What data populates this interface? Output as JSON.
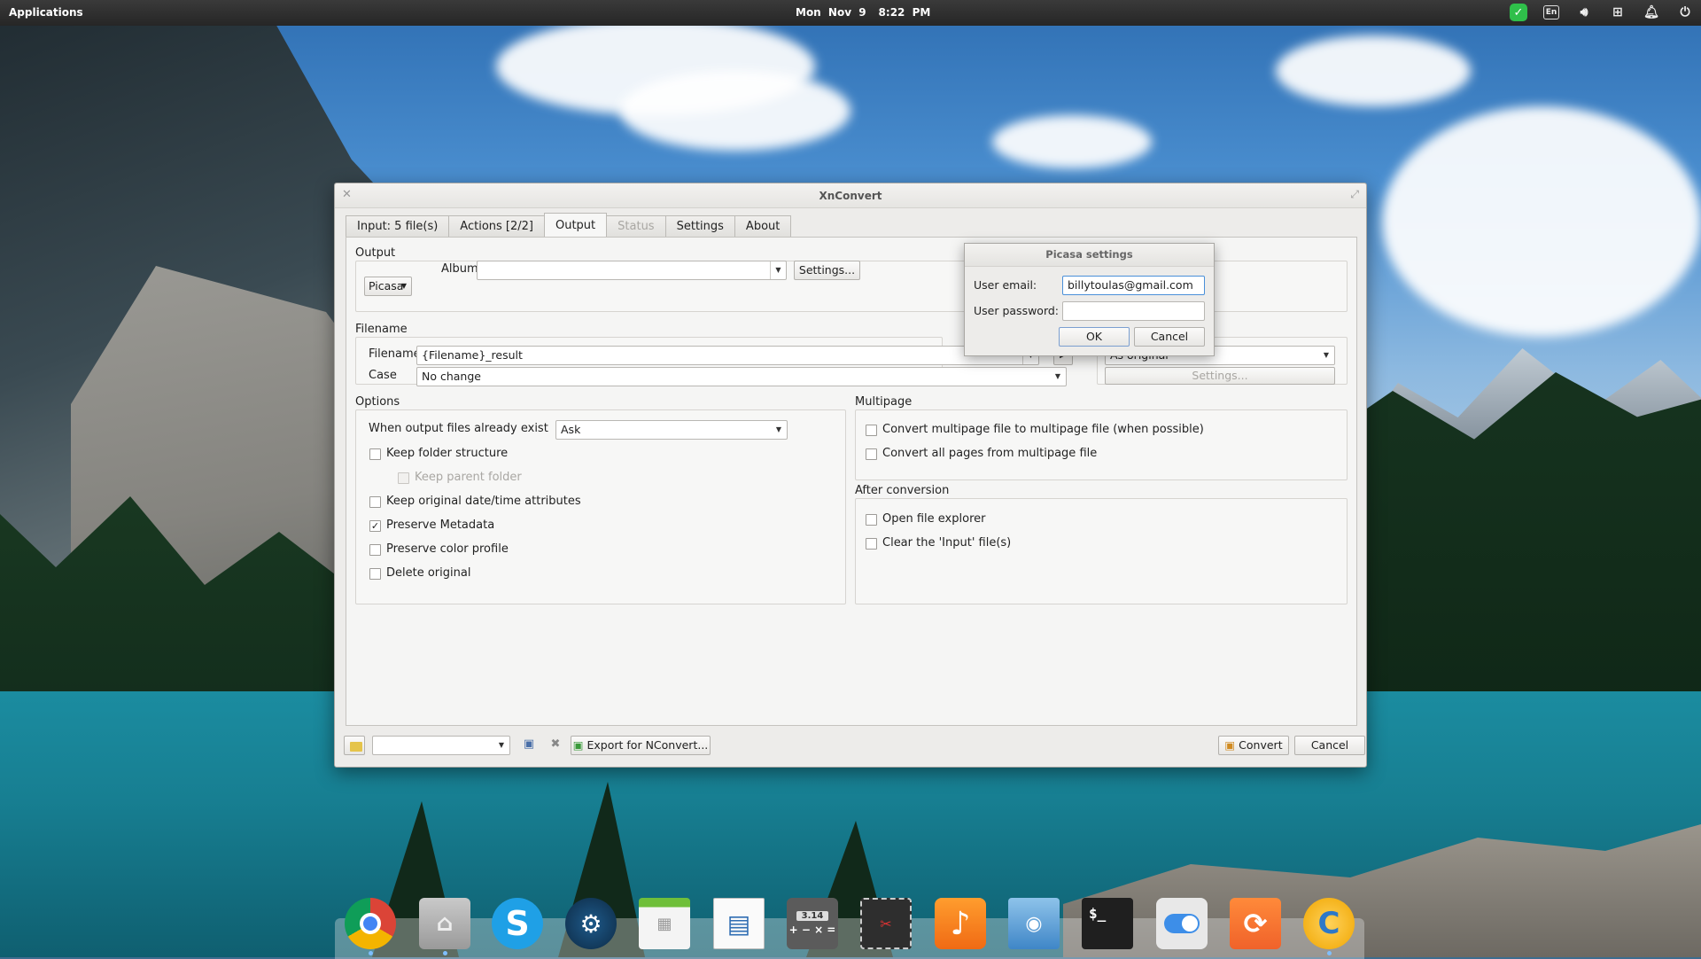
{
  "topbar": {
    "apps_label": "Applications",
    "date": "Mon Nov 9",
    "time": "8:22 PM",
    "tray": [
      "shield-check-icon",
      "keyboard-layout-icon",
      "volume-icon",
      "network-icon",
      "notification-bell-icon",
      "power-icon"
    ],
    "keyboard_layout": "En"
  },
  "window": {
    "title": "XnConvert",
    "tabs": [
      {
        "label": "Input: 5 file(s)",
        "state": "normal"
      },
      {
        "label": "Actions [2/2]",
        "state": "normal"
      },
      {
        "label": "Output",
        "state": "active"
      },
      {
        "label": "Status",
        "state": "disabled"
      },
      {
        "label": "Settings",
        "state": "normal"
      },
      {
        "label": "About",
        "state": "normal"
      }
    ],
    "output": {
      "section": "Output",
      "destination": "Picasa",
      "album_label": "Album:",
      "album_value": "",
      "settings_btn": "Settings..."
    },
    "filename": {
      "section": "Filename",
      "filename_label": "Filename",
      "filename_value": "{Filename}_result",
      "case_label": "Case",
      "case_value": "No change",
      "format_value": "As original",
      "format_settings_btn": "Settings..."
    },
    "options": {
      "section": "Options",
      "exist_label": "When output files already exist",
      "exist_value": "Ask",
      "items": [
        {
          "label": "Keep folder structure",
          "checked": false,
          "disabled": false
        },
        {
          "label": "Keep parent folder",
          "checked": false,
          "disabled": true
        },
        {
          "label": "Keep original date/time attributes",
          "checked": false,
          "disabled": false
        },
        {
          "label": "Preserve Metadata",
          "checked": true,
          "disabled": false
        },
        {
          "label": "Preserve color profile",
          "checked": false,
          "disabled": false
        },
        {
          "label": "Delete original",
          "checked": false,
          "disabled": false
        }
      ]
    },
    "multipage": {
      "section": "Multipage",
      "items": [
        {
          "label": "Convert multipage file to multipage file (when possible)",
          "checked": false
        },
        {
          "label": "Convert all pages from multipage file",
          "checked": false
        }
      ]
    },
    "after": {
      "section": "After conversion",
      "items": [
        {
          "label": "Open file explorer",
          "checked": false
        },
        {
          "label": "Clear the 'Input' file(s)",
          "checked": false
        }
      ]
    },
    "bottom": {
      "preset_value": "",
      "export_btn": "Export for NConvert...",
      "convert_btn": "Convert",
      "cancel_btn": "Cancel"
    }
  },
  "picasa_dialog": {
    "title": "Picasa settings",
    "email_label": "User email:",
    "email_value": "billytoulas@gmail.com",
    "password_label": "User password:",
    "password_value": "",
    "ok_btn": "OK",
    "cancel_btn": "Cancel"
  },
  "dock": {
    "items": [
      "chrome-icon",
      "home-folder-icon",
      "skype-icon",
      "steam-icon",
      "calendar-icon",
      "document-viewer-icon",
      "calculator-icon",
      "screenshot-icon",
      "music-player-icon",
      "image-viewer-icon",
      "terminal-icon",
      "toggle-settings-icon",
      "update-icon",
      "xnconvert-icon"
    ],
    "calculator_display": "3.14",
    "terminal_prompt": "$_"
  }
}
